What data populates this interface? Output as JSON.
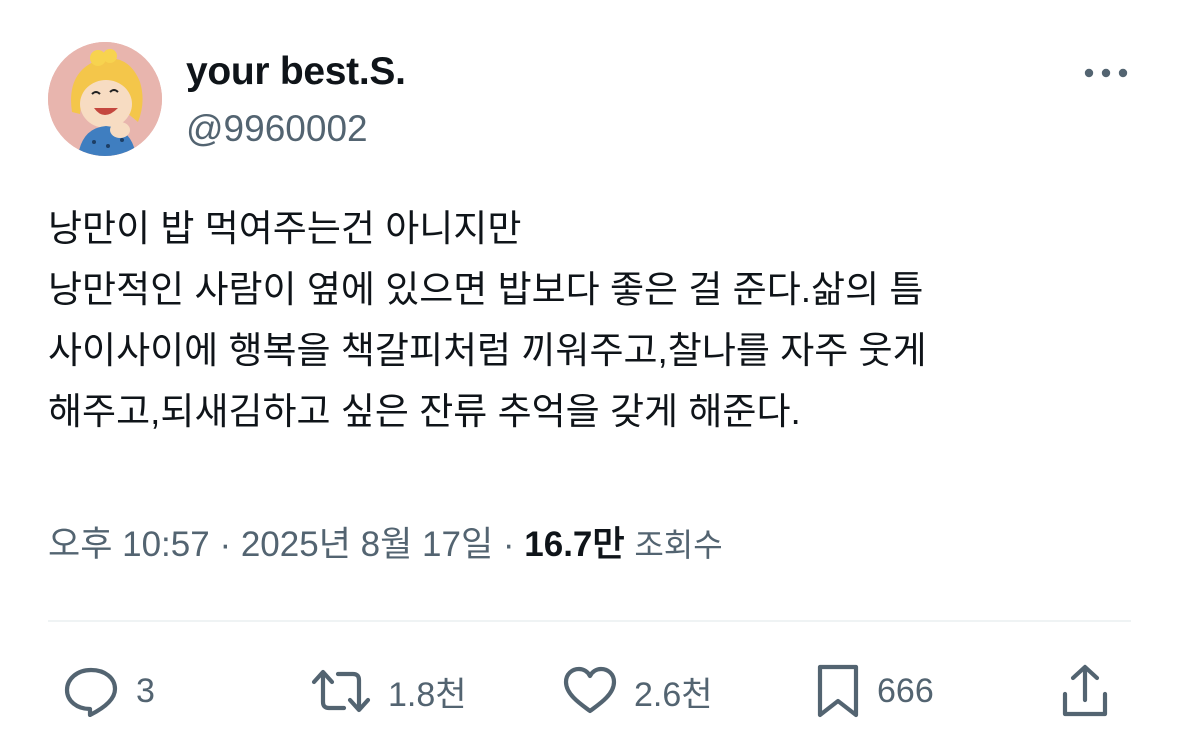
{
  "author": {
    "display_name": "your best.S.",
    "handle": "@9960002"
  },
  "tweet": {
    "lines": [
      "낭만이 밥 먹여주는건 아니지만",
      "낭만적인 사람이 옆에 있으면 밥보다 좋은 걸 준다.삶의 틈",
      "사이사이에 행복을 책갈피처럼 끼워주고,찰나를 자주 웃게",
      "해주고,되새김하고 싶은 잔류 추억을 갖게 해준다."
    ]
  },
  "meta": {
    "time": "오후 10:57",
    "separator": "·",
    "date": "2025년 8월 17일",
    "views_count": "16.7만",
    "views_label": "조회수"
  },
  "actions": {
    "reply": {
      "icon": "reply-icon",
      "count": "3"
    },
    "retweet": {
      "icon": "retweet-icon",
      "count": "1.8천"
    },
    "like": {
      "icon": "heart-icon",
      "count": "2.6천"
    },
    "bookmark": {
      "icon": "bookmark-icon",
      "count": "666"
    },
    "share": {
      "icon": "share-icon"
    }
  },
  "colors": {
    "text_primary": "#0f1419",
    "text_secondary": "#536471",
    "divider": "#eff3f4"
  }
}
